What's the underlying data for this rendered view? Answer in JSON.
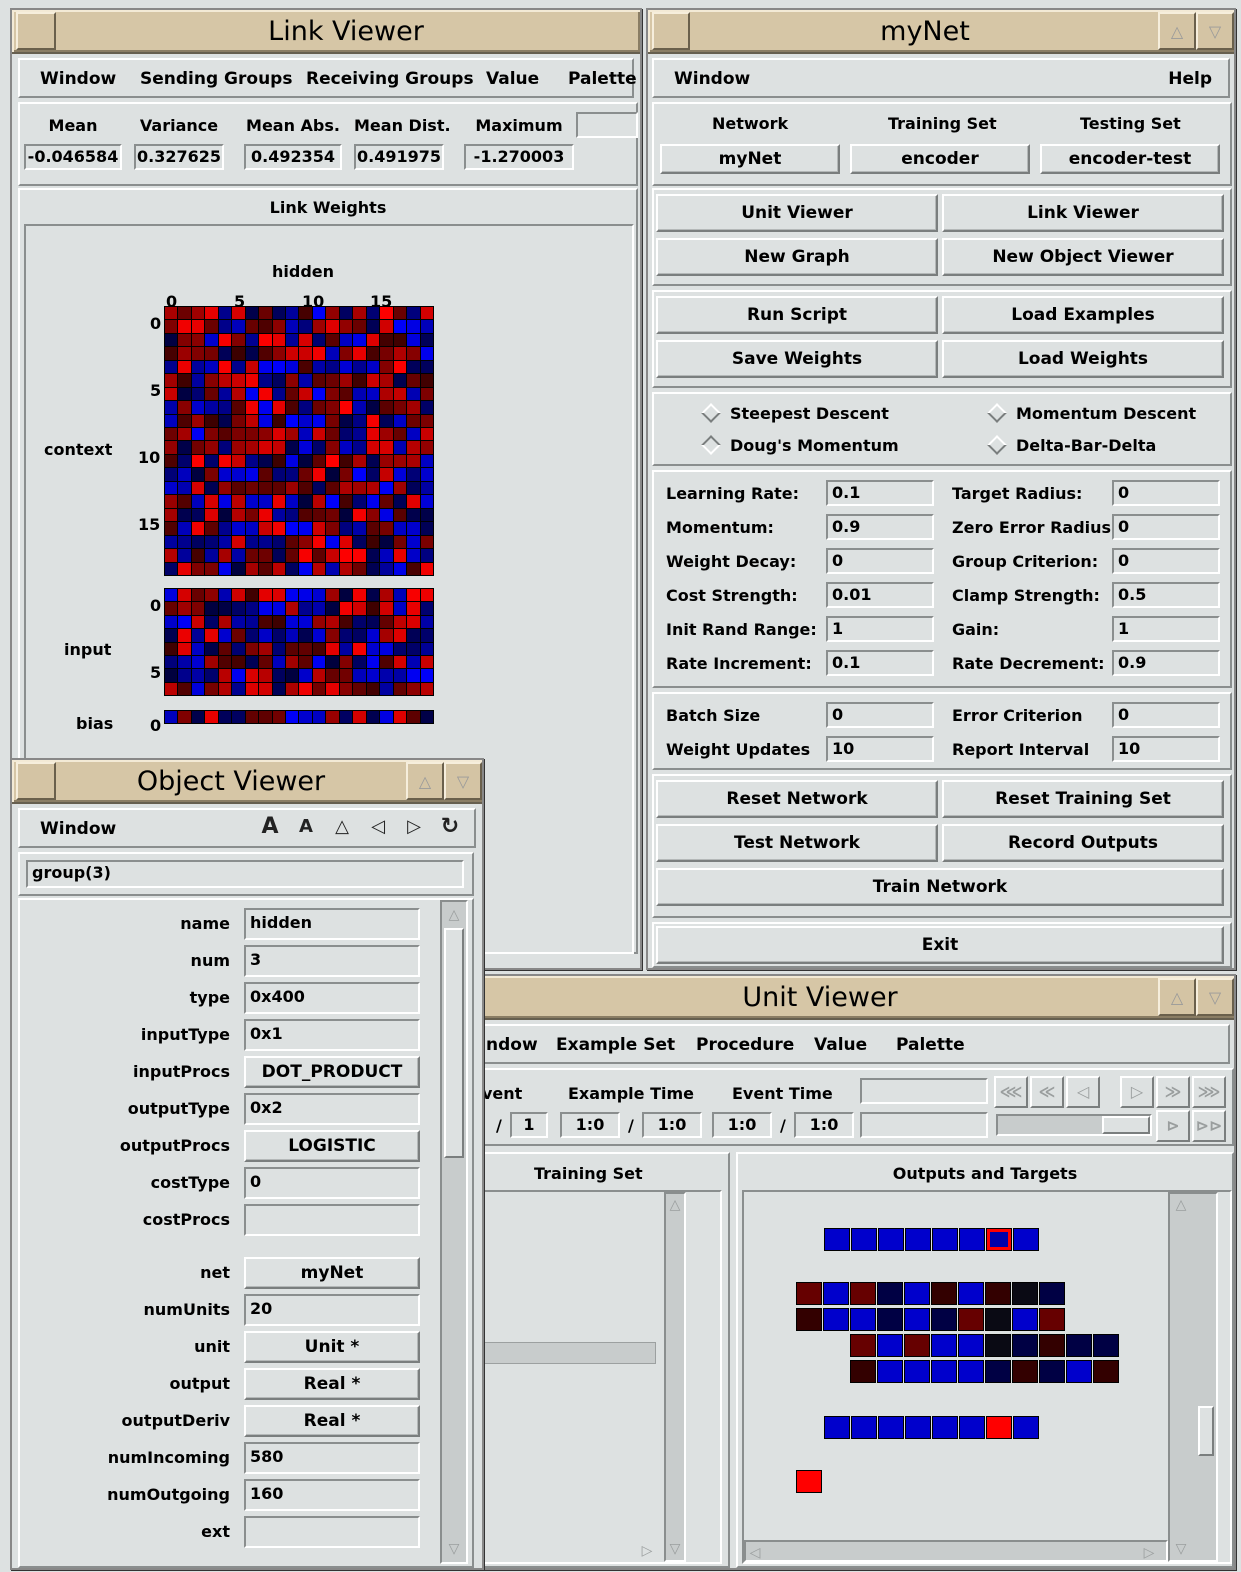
{
  "colors": {
    "red": "#ff0000",
    "blue": "#0000ff",
    "dark": "#000000",
    "titlebar": "#d6c6a6",
    "bg": "#dde1e1"
  },
  "link_viewer": {
    "title": "Link Viewer",
    "menu": [
      "Window",
      "Sending Groups",
      "Receiving Groups",
      "Value",
      "Palette"
    ],
    "stats": {
      "labels": [
        "Mean",
        "Variance",
        "Mean Abs.",
        "Mean Dist.",
        "Maximum"
      ],
      "values": [
        "-0.046584",
        "0.327625",
        "0.492354",
        "0.491975",
        "-1.270003"
      ]
    },
    "panel_title": "Link Weights",
    "receiving_group": "hidden",
    "col_ticks": [
      "0",
      "5",
      "10",
      "15"
    ],
    "groups": [
      {
        "name": "context",
        "ticks": [
          "0",
          "5",
          "10",
          "15"
        ],
        "rows": 20
      },
      {
        "name": "input",
        "ticks": [
          "0",
          "5"
        ],
        "rows": 8
      },
      {
        "name": "bias",
        "ticks": [
          "0"
        ],
        "rows": 1
      }
    ]
  },
  "mynet": {
    "title": "myNet",
    "menu_left": "Window",
    "menu_right": "Help",
    "headers": [
      "Network",
      "Training Set",
      "Testing Set"
    ],
    "values": [
      "myNet",
      "encoder",
      "encoder-test"
    ],
    "buttons1": [
      "Unit Viewer",
      "Link Viewer",
      "New Graph",
      "New Object Viewer"
    ],
    "buttons2": [
      "Run Script",
      "Load Examples",
      "Save Weights",
      "Load Weights"
    ],
    "algorithms": [
      "Steepest Descent",
      "Momentum Descent",
      "Doug's Momentum",
      "Delta-Bar-Delta"
    ],
    "selected_algorithm": "Doug's Momentum",
    "params_left": [
      {
        "label": "Learning Rate:",
        "value": "0.1"
      },
      {
        "label": "Momentum:",
        "value": "0.9"
      },
      {
        "label": "Weight Decay:",
        "value": "0"
      },
      {
        "label": "Cost Strength:",
        "value": "0.01"
      },
      {
        "label": "Init Rand Range:",
        "value": "1"
      },
      {
        "label": "Rate Increment:",
        "value": "0.1"
      }
    ],
    "params_right": [
      {
        "label": "Target Radius:",
        "value": "0"
      },
      {
        "label": "Zero Error Radius:",
        "value": "0"
      },
      {
        "label": "Group Criterion:",
        "value": "0"
      },
      {
        "label": "Clamp Strength:",
        "value": "0.5"
      },
      {
        "label": "Gain:",
        "value": "1"
      },
      {
        "label": "Rate Decrement:",
        "value": "0.9"
      }
    ],
    "batch": [
      {
        "label": "Batch Size",
        "value": "0"
      },
      {
        "label": "Weight Updates",
        "value": "10"
      },
      {
        "label": "Error Criterion",
        "value": "0"
      },
      {
        "label": "Report Interval",
        "value": "10"
      }
    ],
    "buttons3": [
      "Reset Network",
      "Reset Training Set",
      "Test Network",
      "Record Outputs"
    ],
    "train": "Train Network",
    "exit": "Exit"
  },
  "object_viewer": {
    "title": "Object Viewer",
    "menu": "Window",
    "path": "group(3)",
    "fields": [
      {
        "label": "name",
        "value": "hidden",
        "center": false
      },
      {
        "label": "num",
        "value": "3",
        "center": false
      },
      {
        "label": "type",
        "value": "0x400",
        "center": false
      },
      {
        "label": "inputType",
        "value": "0x1",
        "center": false
      },
      {
        "label": "inputProcs",
        "value": "DOT_PRODUCT",
        "center": true
      },
      {
        "label": "outputType",
        "value": "0x2",
        "center": false
      },
      {
        "label": "outputProcs",
        "value": "LOGISTIC",
        "center": true
      },
      {
        "label": "costType",
        "value": "0",
        "center": false
      },
      {
        "label": "costProcs",
        "value": "",
        "center": false
      },
      {
        "label": "net",
        "value": "myNet",
        "center": true
      },
      {
        "label": "numUnits",
        "value": "20",
        "center": false
      },
      {
        "label": "unit",
        "value": "Unit *",
        "center": true
      },
      {
        "label": "output",
        "value": "Real *",
        "center": true
      },
      {
        "label": "outputDeriv",
        "value": "Real *",
        "center": true
      },
      {
        "label": "numIncoming",
        "value": "580",
        "center": false
      },
      {
        "label": "numOutgoing",
        "value": "160",
        "center": false
      },
      {
        "label": "ext",
        "value": "",
        "center": false
      }
    ]
  },
  "unit_viewer": {
    "title": "Unit Viewer",
    "menu": [
      "ndow",
      "Example Set",
      "Procedure",
      "Value",
      "Palette"
    ],
    "time_labels": [
      "vent",
      "Example Time",
      "Event Time"
    ],
    "time_values": [
      "1",
      "1:0",
      "1:0",
      "1:0",
      "1:0"
    ],
    "left_panel": "Training Set",
    "right_panel": "Outputs and Targets"
  }
}
